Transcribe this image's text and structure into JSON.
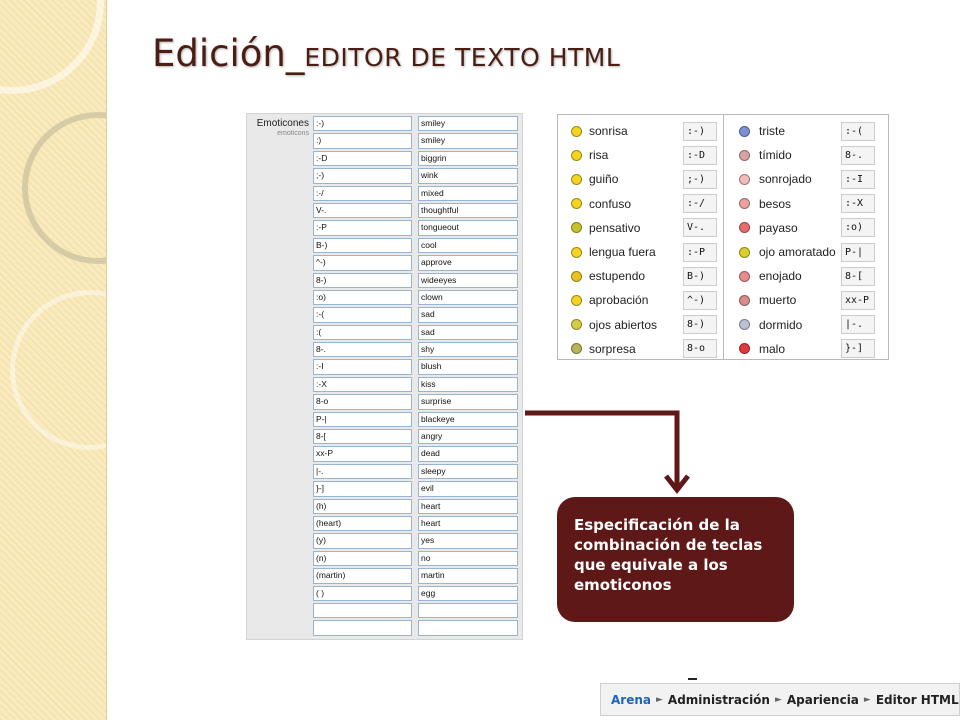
{
  "slide": {
    "title_main": "Edición_",
    "title_sub": "EDITOR DE TEXTO HTML",
    "callout_text": "Especificación de la combinación de teclas que equivale a los emoticonos"
  },
  "emoticon_settings": {
    "label": "Emoticones",
    "sublabel": "emoticons",
    "codes": [
      ":-)",
      ":)",
      ":-D",
      ";-)",
      ":-/",
      "V-.",
      ":-P",
      "B-)",
      "^-)",
      "8-)",
      ":o)",
      ":-(",
      ":(",
      "8-.",
      ":-I",
      ":-X",
      "8-o",
      "P-|",
      "8-[",
      "xx-P",
      "|-.",
      "}-]",
      "(h)",
      "(heart)",
      "(y)",
      "(n)",
      "(martin)",
      "( )",
      "",
      ""
    ],
    "names": [
      "smiley",
      "smiley",
      "biggrin",
      "wink",
      "mixed",
      "thoughtful",
      "tongueout",
      "cool",
      "approve",
      "wideeyes",
      "clown",
      "sad",
      "sad",
      "shy",
      "blush",
      "kiss",
      "surprise",
      "blackeye",
      "angry",
      "dead",
      "sleepy",
      "evil",
      "heart",
      "heart",
      "yes",
      "no",
      "martin",
      "egg",
      "",
      ""
    ]
  },
  "smiley_reference": {
    "left": [
      {
        "name": "sonrisa",
        "code": ":-)",
        "color": "#f3d421"
      },
      {
        "name": "risa",
        "code": ":-D",
        "color": "#f3d421"
      },
      {
        "name": "guiño",
        "code": ";-)",
        "color": "#f3d421"
      },
      {
        "name": "confuso",
        "code": ":-/",
        "color": "#f3d421"
      },
      {
        "name": "pensativo",
        "code": "V-.",
        "color": "#c8c22a"
      },
      {
        "name": "lengua fuera",
        "code": ":-P",
        "color": "#f3d421"
      },
      {
        "name": "estupendo",
        "code": "B-)",
        "color": "#e8c31f"
      },
      {
        "name": "aprobación",
        "code": "^-)",
        "color": "#f3d421"
      },
      {
        "name": "ojos abiertos",
        "code": "8-)",
        "color": "#d6cd45"
      },
      {
        "name": "sorpresa",
        "code": "8-o",
        "color": "#b9b35a"
      }
    ],
    "right": [
      {
        "name": "triste",
        "code": ":-(",
        "color": "#7b8fd6"
      },
      {
        "name": "tímido",
        "code": "8-.",
        "color": "#d9a3a3"
      },
      {
        "name": "sonrojado",
        "code": ":-I",
        "color": "#f2b9b9"
      },
      {
        "name": "besos",
        "code": ":-X",
        "color": "#ee9f9f"
      },
      {
        "name": "payaso",
        "code": ":o)",
        "color": "#e86b6b"
      },
      {
        "name": "ojo amoratado",
        "code": "P-|",
        "color": "#d8cf2c"
      },
      {
        "name": "enojado",
        "code": "8-[",
        "color": "#e58c8c"
      },
      {
        "name": "muerto",
        "code": "xx-P",
        "color": "#d98a8a"
      },
      {
        "name": "dormido",
        "code": "|-.",
        "color": "#b9c2d1"
      },
      {
        "name": "malo",
        "code": "}-]",
        "color": "#e0393b"
      }
    ]
  },
  "breadcrumb": {
    "items": [
      "Arena",
      "Administración",
      "Apariencia",
      "Editor HTML"
    ]
  },
  "colors": {
    "title": "#4b1e14",
    "callout_bg": "#5e1818",
    "arrow": "#5e1818",
    "breadcrumb_link": "#1e63b4"
  }
}
